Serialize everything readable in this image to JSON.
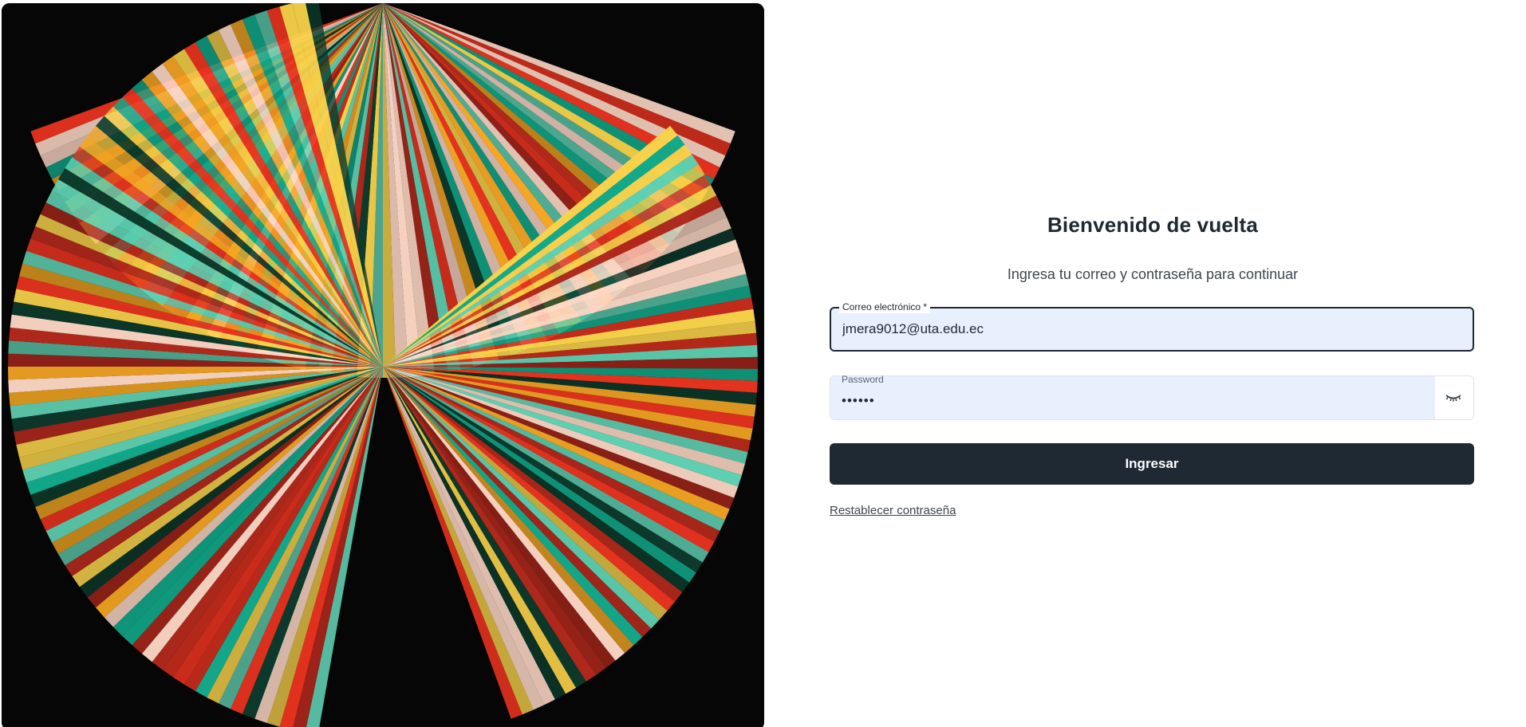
{
  "artwork": {
    "icon": "abstract-fan-artwork",
    "colors": [
      "#e8331f",
      "#f5a623",
      "#f8d24a",
      "#ffd9c7",
      "#11a98a",
      "#5fd1b3",
      "#0c3b2c",
      "#b0281c"
    ]
  },
  "login": {
    "title": "Bienvenido de vuelta",
    "subtitle": "Ingresa tu correo y contraseña para continuar",
    "email": {
      "label": "Correo electrónico *",
      "value": "jmera9012@uta.edu.ec"
    },
    "password": {
      "label": "Password",
      "value": "••••••",
      "toggle_icon": "eye-closed-icon"
    },
    "submit_label": "Ingresar",
    "reset_link": "Restablecer contraseña"
  },
  "theme": {
    "primary": "#1f2933",
    "field_fill": "#e8f0fe",
    "background": "#ffffff"
  }
}
